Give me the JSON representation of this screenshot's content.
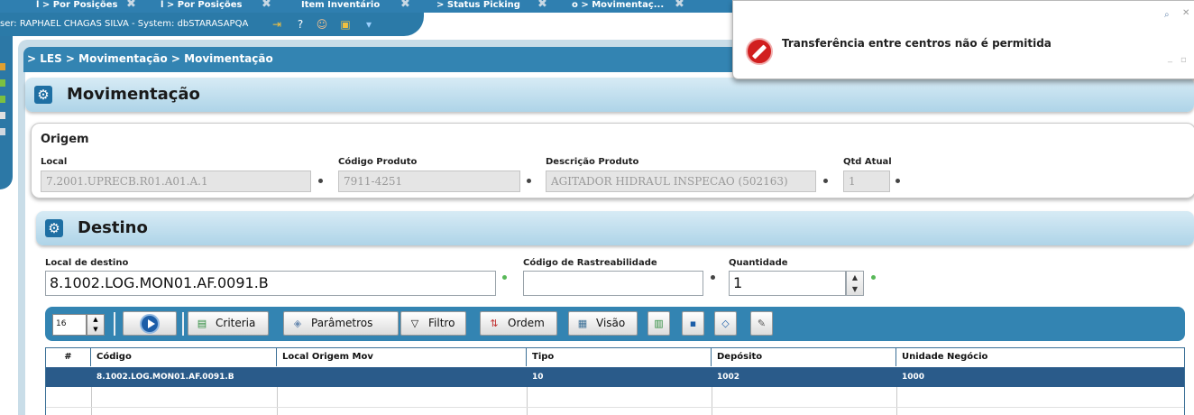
{
  "tabs": [
    {
      "label": "l > Por Posições"
    },
    {
      "label": "l > Por Posições"
    },
    {
      "label": "Item Inventário"
    },
    {
      "label": "> Status Picking"
    },
    {
      "label": "o > Movimentaç..."
    }
  ],
  "session_text": "ser: RAPHAEL CHAGAS SILVA - System: dbSTARASAPQA",
  "breadcrumb": "> LES > Movimentação > Movimentação",
  "page_title": "Movimentação",
  "origem": {
    "title": "Origem",
    "local_label": "Local",
    "local_value": "7.2001.UPRECB.R01.A01.A.1",
    "codigo_label": "Código Produto",
    "codigo_value": "7911-4251",
    "descricao_label": "Descrição Produto",
    "descricao_value": "AGITADOR HIDRAUL INSPECAO (502163)",
    "qtd_label": "Qtd Atual",
    "qtd_value": "1"
  },
  "destino": {
    "title": "Destino",
    "local_label": "Local de destino",
    "local_value": "8.1002.LOG.MON01.AF.0091.B",
    "rastreabilidade_label": "Código de Rastreabilidade",
    "rastreabilidade_value": "",
    "quantidade_label": "Quantidade",
    "quantidade_value": "1"
  },
  "toolbar": {
    "page_size": "16",
    "criteria": "Criteria",
    "parametros": "Parâmetros",
    "filtro": "Filtro",
    "ordem": "Ordem",
    "visao": "Visão"
  },
  "grid": {
    "columns": [
      "#",
      "Código",
      "Local Origem Mov",
      "Tipo",
      "Depósito",
      "Unidade Negócio"
    ],
    "rows": [
      [
        "",
        "8.1002.LOG.MON01.AF.0091.B",
        "",
        "10",
        "1002",
        "1000"
      ]
    ]
  },
  "notification": {
    "message": "Transferência entre centros não é permitida"
  },
  "colors": {
    "accent_blue": "#3384b2",
    "selected_row": "#2a5b8a",
    "error_red": "#d11f1f"
  },
  "icons": {
    "tab_close": "close-icon",
    "notification": "stop-icon",
    "play": "play-icon"
  }
}
